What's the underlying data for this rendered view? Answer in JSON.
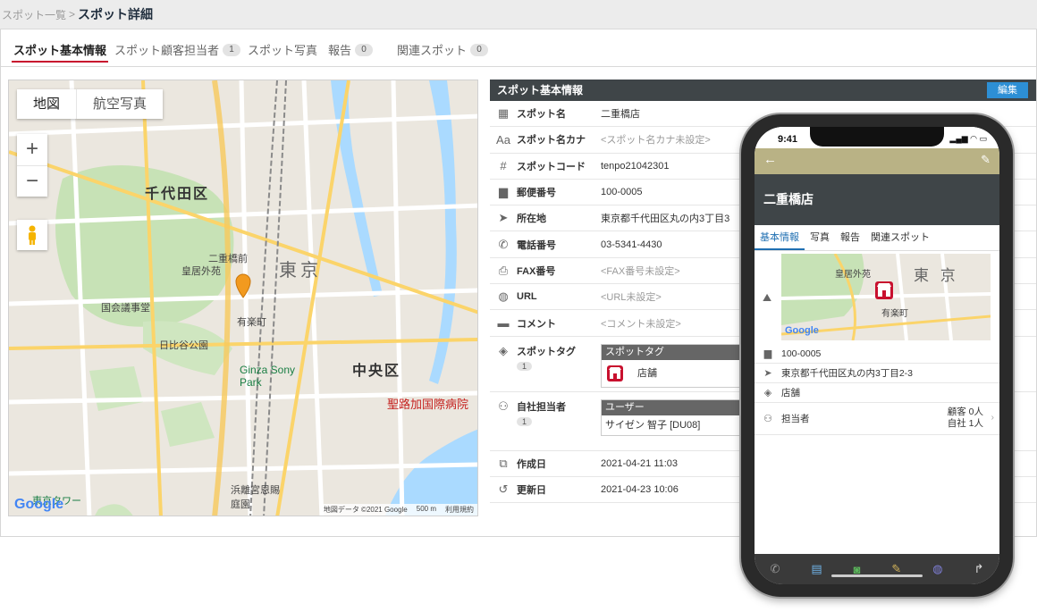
{
  "breadcrumb": {
    "parent": "スポット一覧",
    "separator": ">",
    "current": "スポット詳細"
  },
  "tabs": [
    {
      "label": "スポット基本情報",
      "active": true
    },
    {
      "label": "スポット顧客担当者",
      "badge": "1"
    },
    {
      "label": "スポット写真"
    },
    {
      "label": "報告",
      "badge": "0"
    },
    {
      "label": "関連スポット",
      "badge": "0"
    }
  ],
  "map": {
    "type_map": "地図",
    "type_satellite": "航空写真",
    "zoom_in": "+",
    "zoom_out": "−",
    "labels": {
      "chiyoda": "千代田区",
      "chuo": "中央区",
      "tokyo": "東京",
      "hospital": "聖路加国際病院",
      "nihonbashi": "二重橋前",
      "kokyo": "皇居外苑",
      "yurakucho": "有楽町",
      "ginza": "Ginza Sony Park",
      "tokyo_tower": "東京タワー",
      "hamarikyu": "浜離宮恩賜庭園",
      "kokkai": "国会議事堂",
      "hibiya": "日比谷公園"
    },
    "google": "Google",
    "footer": {
      "data": "地図データ ©2021 Google",
      "scale": "500 m",
      "terms": "利用規約"
    }
  },
  "info": {
    "header": "スポット基本情報",
    "edit_button": "編集",
    "rows": [
      {
        "icon": "building-icon",
        "glyph": "▦",
        "label": "スポット名",
        "value": "二重橋店"
      },
      {
        "icon": "kana-icon",
        "glyph": "Aa",
        "label": "スポット名カナ",
        "value": "<スポット名カナ未設定>",
        "empty": true
      },
      {
        "icon": "hash-icon",
        "glyph": "#",
        "label": "スポットコード",
        "value": "tenpo21042301"
      },
      {
        "icon": "mailbox-icon",
        "glyph": "▆",
        "label": "郵便番号",
        "value": "100-0005"
      },
      {
        "icon": "location-arrow-icon",
        "glyph": "➤",
        "label": "所在地",
        "value": "東京都千代田区丸の内3丁目3"
      },
      {
        "icon": "phone-icon",
        "glyph": "✆",
        "label": "電話番号",
        "value": "03-5341-4430"
      },
      {
        "icon": "fax-icon",
        "glyph": "⎙",
        "label": "FAX番号",
        "value": "<FAX番号未設定>",
        "empty": true
      },
      {
        "icon": "globe-icon",
        "glyph": "◍",
        "label": "URL",
        "value": "<URL未設定>",
        "empty": true
      },
      {
        "icon": "comment-icon",
        "glyph": "▬",
        "label": "コメント",
        "value": "<コメント未設定>",
        "empty": true
      }
    ],
    "tag": {
      "label": "スポットタグ",
      "badge": "1",
      "table_header": "スポットタグ",
      "value": "店舗"
    },
    "owner": {
      "label": "自社担当者",
      "badge": "1",
      "table_header": "ユーザー",
      "value": "サイゼン 智子 [DU08]"
    },
    "created": {
      "label": "作成日",
      "value": "2021-04-21 11:03"
    },
    "updated": {
      "label": "更新日",
      "value": "2021-04-23 10:06"
    }
  },
  "phone": {
    "time": "9:41",
    "title": "二重橋店",
    "tabs": [
      "基本情報",
      "写真",
      "報告",
      "関連スポット"
    ],
    "map_labels": {
      "kokyo": "皇居外苑",
      "tokyo": "東 京",
      "yurakucho": "有楽町",
      "google": "Google"
    },
    "postal": "100-0005",
    "address": "東京都千代田区丸の内3丁目2-3",
    "tag": "店舗",
    "owner_label": "担当者",
    "customer_count": "顧客 0人",
    "company_count": "自社 1人"
  },
  "colors": {
    "header_bg": "#3f4548",
    "edit_button": "#2d8fd5",
    "active_tab_underline": "#c8102e",
    "phone_nav": "#b9b285"
  }
}
